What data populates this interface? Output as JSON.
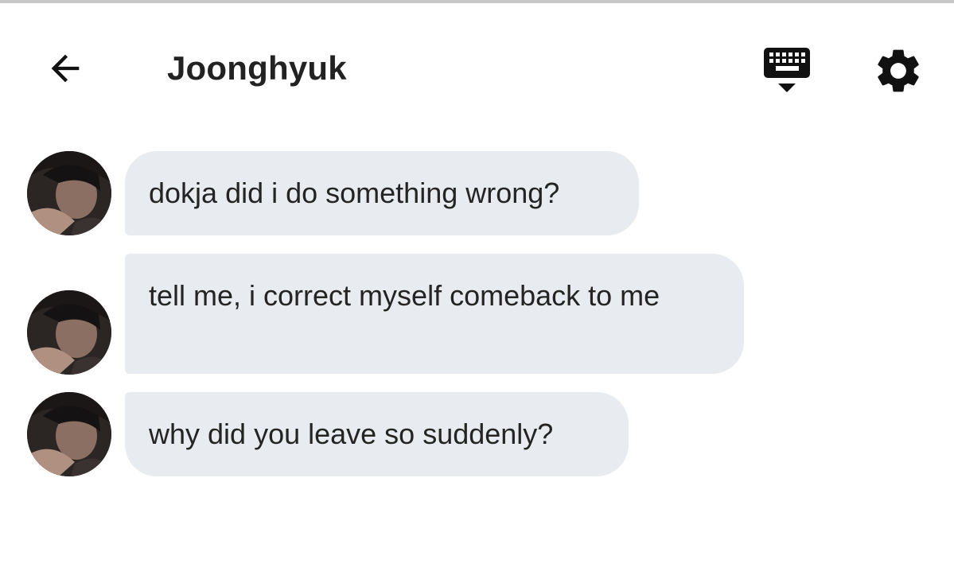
{
  "header": {
    "title": "Joonghyuk",
    "back_icon": "arrow-left-icon",
    "keyboard_icon": "keyboard-hide-icon",
    "settings_icon": "gear-icon"
  },
  "contact": {
    "avatar": "avatar"
  },
  "messages": [
    {
      "text": "dokja did i do something wrong?"
    },
    {
      "text": "tell me, i correct myself comeback to me"
    },
    {
      "text": "why did you leave so suddenly?"
    }
  ],
  "colors": {
    "bubble_bg": "#e8ebef",
    "text": "#242424",
    "icon": "#111111",
    "background": "#ffffff"
  }
}
